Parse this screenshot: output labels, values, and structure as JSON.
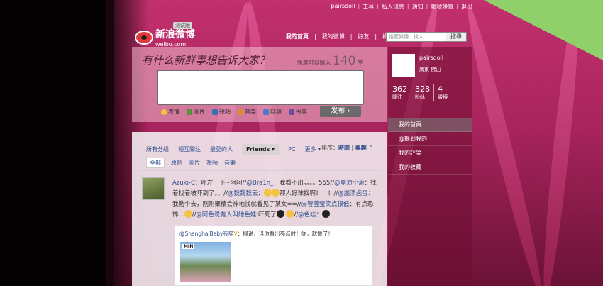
{
  "topnav": {
    "username": "pairsdoll",
    "tools": "工具",
    "messages": "私人讯息",
    "notify": "通知",
    "account": "帐號設置",
    "logout": "退出"
  },
  "header": {
    "logo_cn": "新浪微博",
    "logo_en": "weibo.com",
    "beta": "测试版",
    "nav": [
      "我的首頁",
      "我的微博",
      "好友",
      "模板"
    ],
    "search_placeholder": "搜索微博、找人",
    "search_button": "搜尋"
  },
  "publish": {
    "slogan": "有什么新鲜事想告诉大家？",
    "counter_prefix": "你還可以輸入",
    "counter_num": "140",
    "counter_unit": "字",
    "tools": [
      "表情",
      "圖片",
      "視頻",
      "音樂",
      "話題",
      "投票"
    ],
    "post_button": "发布"
  },
  "feed": {
    "filters": [
      "所有分組",
      "相互關注",
      "最愛的人",
      "Friends ▾",
      "PC",
      "更多 ▾"
    ],
    "sort_label": "排序：",
    "sort_time": "時間",
    "sort_sep": "|",
    "sort_hot": "興趣",
    "sub_filters": [
      "全部",
      "原創",
      "圖片",
      "視頻",
      "音樂"
    ],
    "post": {
      "author": "Azuki-C",
      "line1": "：吓左一下~阿呵//",
      "m1": "@Bra1n_",
      "line1b": "：我看不出。。。。555//",
      "m2": "@崩溃小滚",
      "line2": "：找着找着被吓到了。。//",
      "m3": "@魏魏魏云",
      "line2b": "：",
      "line2c": "那人好难找啊！！！//",
      "m4": "@崩溃卤蛋",
      "line3": "：我勒个去，刚刚聚精会神地找就看见了某女==//",
      "m5": "@管莹莹笑点很低",
      "line3b": "：有点恐怖...",
      "line4": "//",
      "m6": "@阿色说有人叫她色娃",
      "line4b": ":吓死了",
      "line4c": "//",
      "m7": "@色娃",
      "line4d": "：",
      "repost_author": "@ShanghaiBaby夜猫",
      "repost_text": "：摄说，当你看出亮点时！你，就惨了！",
      "photo_tag": "MIN"
    }
  },
  "side": {
    "name": "pairsdoll",
    "location": "廣東  佛山",
    "stats": [
      {
        "num": "362",
        "label": "關注"
      },
      {
        "num": "328",
        "label": "粉絲"
      },
      {
        "num": "4",
        "label": "微博"
      }
    ],
    "menu": [
      "我的首頁",
      "@提到我的",
      "我的評論",
      "我的收藏"
    ]
  },
  "colors": {
    "link": "#2f4f8f",
    "background_pink": "#a8245c",
    "sidebar": "#6e0f32"
  }
}
